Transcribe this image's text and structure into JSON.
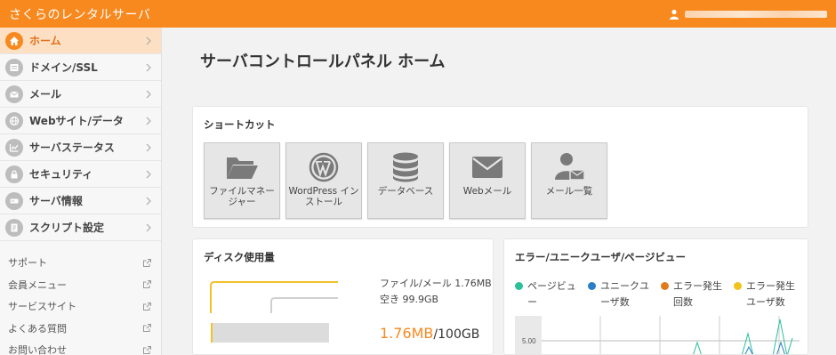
{
  "header": {
    "brand": "さくらのレンタルサーバ",
    "user_name": "●●●●●●●●●●●●"
  },
  "sidebar": {
    "items": [
      {
        "label": "ホーム",
        "icon": "home-icon",
        "active": true
      },
      {
        "label": "ドメイン/SSL",
        "icon": "domain-icon",
        "active": false
      },
      {
        "label": "メール",
        "icon": "mail-icon",
        "active": false
      },
      {
        "label": "Webサイト/データ",
        "icon": "globe-icon",
        "active": false
      },
      {
        "label": "サーバステータス",
        "icon": "status-chart-icon",
        "active": false
      },
      {
        "label": "セキュリティ",
        "icon": "lock-icon",
        "active": false
      },
      {
        "label": "サーバ情報",
        "icon": "server-info-icon",
        "active": false
      },
      {
        "label": "スクリプト設定",
        "icon": "script-icon",
        "active": false
      }
    ],
    "links": [
      {
        "label": "サポート"
      },
      {
        "label": "会員メニュー"
      },
      {
        "label": "サービスサイト"
      },
      {
        "label": "よくある質問"
      },
      {
        "label": "お問い合わせ"
      }
    ]
  },
  "main": {
    "title": "サーバコントロールパネル ホーム",
    "shortcuts": {
      "title": "ショートカット",
      "items": [
        {
          "label": "ファイルマネージャー",
          "icon": "folder-icon"
        },
        {
          "label": "WordPress インストール",
          "icon": "wordpress-icon"
        },
        {
          "label": "データベース",
          "icon": "database-icon"
        },
        {
          "label": "Webメール",
          "icon": "envelope-icon"
        },
        {
          "label": "メール一覧",
          "icon": "user-mail-icon"
        }
      ]
    },
    "disk": {
      "title": "ディスク使用量",
      "file_mail": "ファイル/メール 1.76MB",
      "free": "空き 99.9GB",
      "used": "1.76MB",
      "total": "/100GB",
      "used_fraction": 1.76e-05
    },
    "errors": {
      "title": "エラー/ユニークユーザ/ページビュー",
      "legend": [
        {
          "label": "ページビュー",
          "color": "#2bbf9a"
        },
        {
          "label": "ユニークユーザ数",
          "color": "#2a7fc4"
        },
        {
          "label": "エラー発生回数",
          "color": "#e07b1c"
        },
        {
          "label": "エラー発生ユーザ数",
          "color": "#f0c21a"
        }
      ],
      "y_tick": "5.00"
    }
  },
  "colors": {
    "accent": "#f7891f"
  }
}
